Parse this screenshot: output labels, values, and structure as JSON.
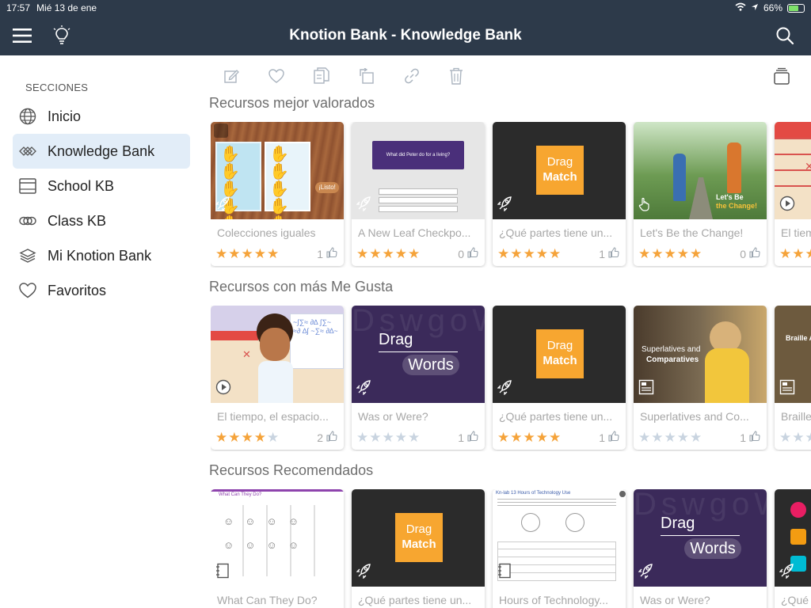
{
  "status": {
    "time": "17:57",
    "date": "Mié 13 de ene",
    "battery": "66%",
    "battery_level": 0.66
  },
  "nav": {
    "title": "Knotion Bank - Knowledge Bank",
    "menu_icon": "hamburger-menu-icon",
    "idea_icon": "lightbulb-icon",
    "search_icon": "search-icon"
  },
  "sidebar": {
    "heading": "SECCIONES",
    "items": [
      {
        "label": "Inicio",
        "icon": "globe-icon",
        "active": false
      },
      {
        "label": "Knowledge Bank",
        "icon": "diamond-pattern-icon",
        "active": true
      },
      {
        "label": "School KB",
        "icon": "browser-window-icon",
        "active": false
      },
      {
        "label": "Class KB",
        "icon": "chain-icon",
        "active": false
      },
      {
        "label": "Mi Knotion Bank",
        "icon": "layers-icon",
        "active": false
      },
      {
        "label": "Favoritos",
        "icon": "heart-icon",
        "active": false
      }
    ]
  },
  "toolbar": {
    "icons": [
      "edit-icon",
      "heart-icon",
      "copy-icon",
      "move-icon",
      "link-icon",
      "trash-icon"
    ],
    "right_icon": "stack-icon"
  },
  "sections": [
    {
      "title": "Recursos mejor valorados",
      "cards": [
        {
          "title": "Colecciones iguales",
          "rating": 5,
          "likes": "1",
          "thumb": "hands"
        },
        {
          "title": "A New Leaf Checkpo...",
          "rating": 5,
          "likes": "0",
          "thumb": "quiz",
          "quiz_text": "What did Peter do for a living?"
        },
        {
          "title": "¿Qué partes tiene un...",
          "rating": 5,
          "likes": "1",
          "thumb": "dragmatch",
          "l1": "Drag",
          "l2": "Match"
        },
        {
          "title": "Let's Be the Change!",
          "rating": 5,
          "likes": "0",
          "thumb": "park",
          "t1": "Let's Be",
          "t2": "the Change!"
        },
        {
          "title": "El tiem",
          "rating": 5,
          "likes": "",
          "thumb": "calendar"
        }
      ]
    },
    {
      "title": "Recursos con más Me Gusta",
      "cards": [
        {
          "title": "El tiempo, el espacio...",
          "rating": 4,
          "likes": "2",
          "thumb": "scientist"
        },
        {
          "title": "Was or Were?",
          "rating": 0,
          "likes": "1",
          "thumb": "dragwords",
          "l1": "Drag",
          "l2": "Words"
        },
        {
          "title": "¿Qué partes tiene un...",
          "rating": 5,
          "likes": "1",
          "thumb": "dragmatch",
          "l1": "Drag",
          "l2": "Match"
        },
        {
          "title": "Superlatives and Co...",
          "rating": 0,
          "likes": "1",
          "thumb": "reader",
          "t1": "Superlatives and",
          "t2": "Comparatives"
        },
        {
          "title": "Braille",
          "rating": 0,
          "likes": "",
          "thumb": "braille",
          "t1": "Braille A"
        }
      ]
    },
    {
      "title": "Recursos Recomendados",
      "cards": [
        {
          "title": "What Can They Do?",
          "thumb": "worksheet",
          "t1": "What Can They Do?"
        },
        {
          "title": "¿Qué partes tiene un...",
          "thumb": "dragmatch",
          "l1": "Drag",
          "l2": "Match"
        },
        {
          "title": "Hours of Technology...",
          "thumb": "doc",
          "t1": "Kn-lab 13 Hours of Technology Use"
        },
        {
          "title": "Was or Were?",
          "thumb": "dragwords",
          "l1": "Drag",
          "l2": "Words"
        },
        {
          "title": "¿Qué",
          "thumb": "game"
        }
      ]
    }
  ],
  "colors": {
    "nav_bg": "#2d3a4a",
    "star": "#f5a33a",
    "star_off": "#c9d4e0",
    "active_bg": "#e2edf8",
    "drag_match": "#f7a630",
    "drag_words_bg": "#3b2a5a"
  }
}
